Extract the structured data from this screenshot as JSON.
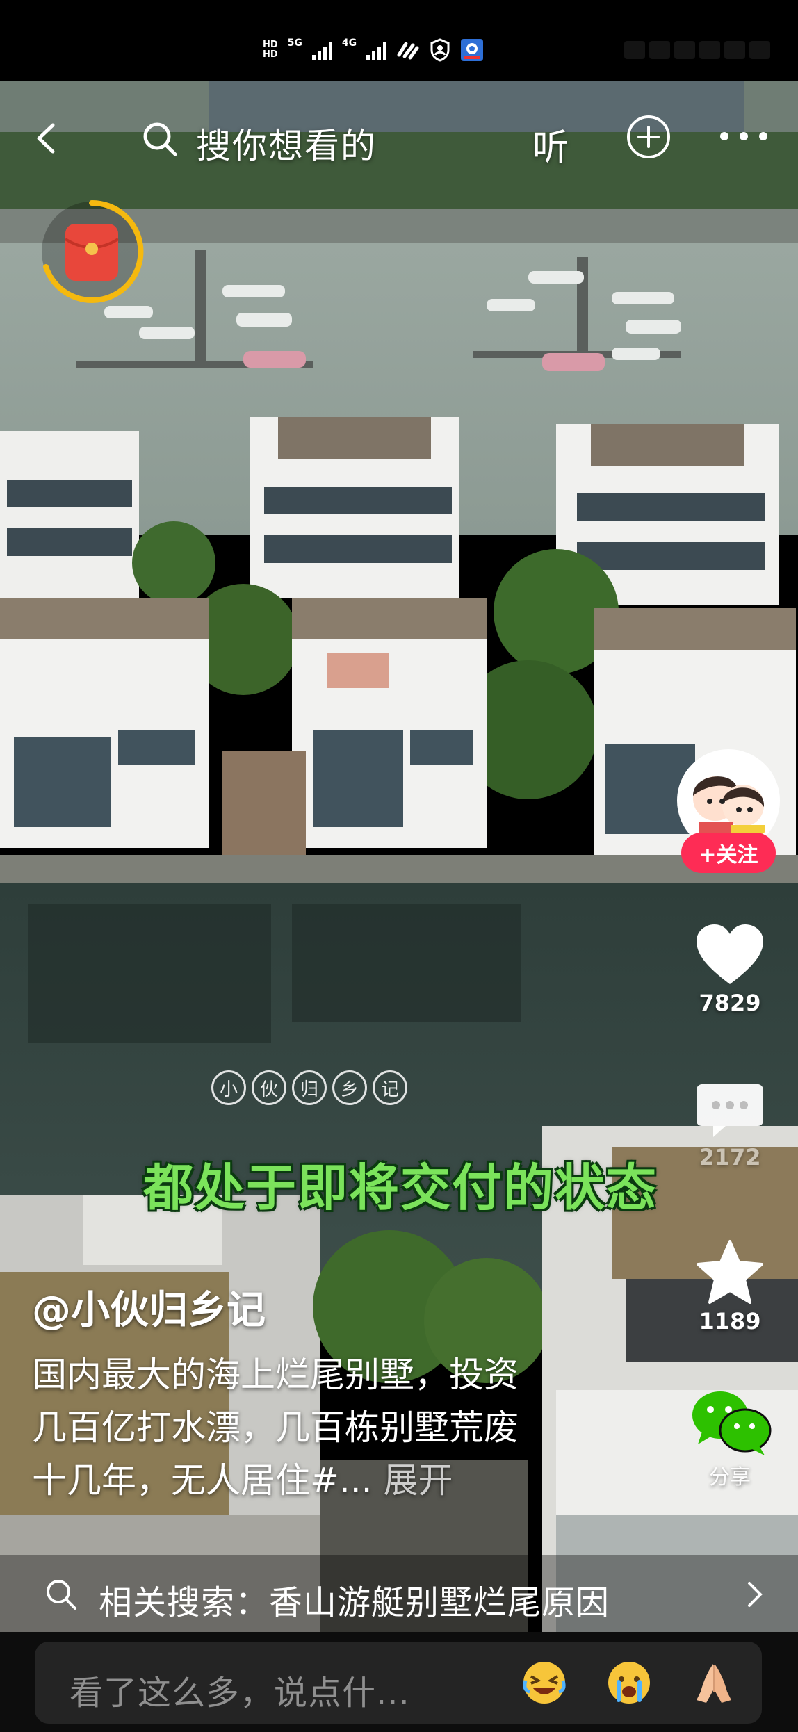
{
  "status_bar": {
    "hd_top": "HD",
    "hd_bottom": "HD",
    "net1": "5G",
    "net2": "4G"
  },
  "top_nav": {
    "search_placeholder": "搜你想看的",
    "listen_label": "听"
  },
  "creator": {
    "follow_label": "+关注"
  },
  "actions": {
    "likes": "7829",
    "comments": "2172",
    "favorites": "1189",
    "share_label": "分享"
  },
  "video": {
    "watermark": [
      "小",
      "伙",
      "归",
      "乡",
      "记"
    ],
    "subtitle": "都处于即将交付的状态"
  },
  "caption": {
    "author": "@小伙归乡记",
    "line1": "国内最大的海上烂尾别墅，投资",
    "line2": "几百亿打水漂，几百栋别墅荒废",
    "line3": "十几年，无人居住#...",
    "expand": "展开"
  },
  "related_search": {
    "text": "相关搜索：香山游艇别墅烂尾原因"
  },
  "comment_bar": {
    "placeholder": "看了这么多，说点什..."
  },
  "colors": {
    "follow_red": "#fe2c55",
    "subtitle_green": "#7be35b",
    "redpacket_ring": "#f5b90f"
  }
}
